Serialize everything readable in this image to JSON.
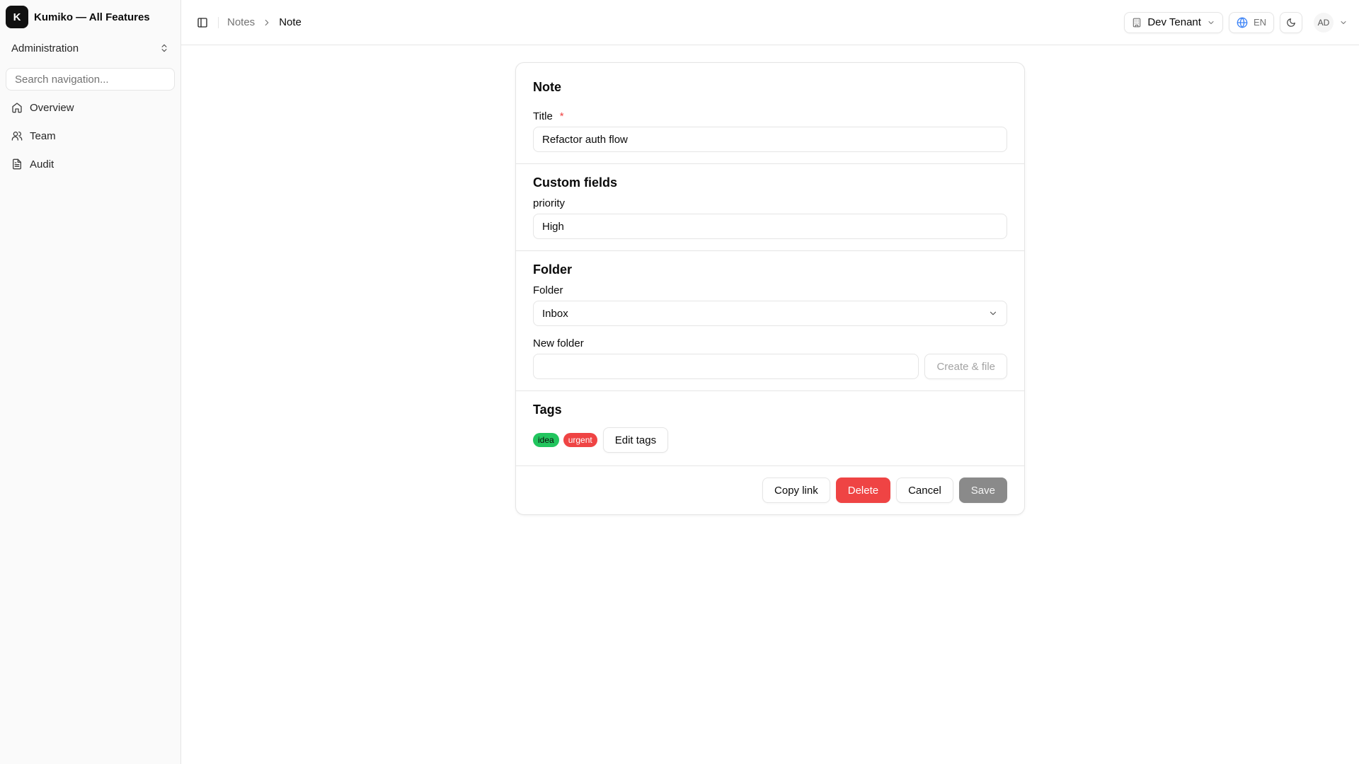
{
  "app": {
    "logo_letter": "K",
    "name": "Kumiko — All Features",
    "workspace": "Administration"
  },
  "sidebar": {
    "search_placeholder": "Search navigation...",
    "items": [
      {
        "label": "Overview",
        "icon": "home-icon"
      },
      {
        "label": "Team",
        "icon": "users-icon"
      },
      {
        "label": "Audit",
        "icon": "file-text-icon"
      }
    ]
  },
  "header": {
    "breadcrumb": [
      "Notes",
      "Note"
    ],
    "tenant": "Dev Tenant",
    "language": "EN",
    "user_initials": "AD"
  },
  "form": {
    "title": "Note",
    "title_label": "Title",
    "required_mark": "*",
    "title_value": "Refactor auth flow",
    "custom_fields_title": "Custom fields",
    "priority_label": "priority",
    "priority_value": "High",
    "folder_section_title": "Folder",
    "folder_label": "Folder",
    "folder_value": "Inbox",
    "new_folder_label": "New folder",
    "new_folder_value": "",
    "create_file_label": "Create & file",
    "tags_title": "Tags",
    "tags": [
      {
        "label": "idea",
        "color": "#22c55e"
      },
      {
        "label": "urgent",
        "color": "#ef4444"
      }
    ],
    "edit_tags_label": "Edit tags"
  },
  "actions": {
    "copy_link": "Copy link",
    "delete": "Delete",
    "cancel": "Cancel",
    "save": "Save"
  },
  "colors": {
    "danger": "#ef4444",
    "success": "#22c55e",
    "disabled_primary": "#8a8a8a"
  }
}
